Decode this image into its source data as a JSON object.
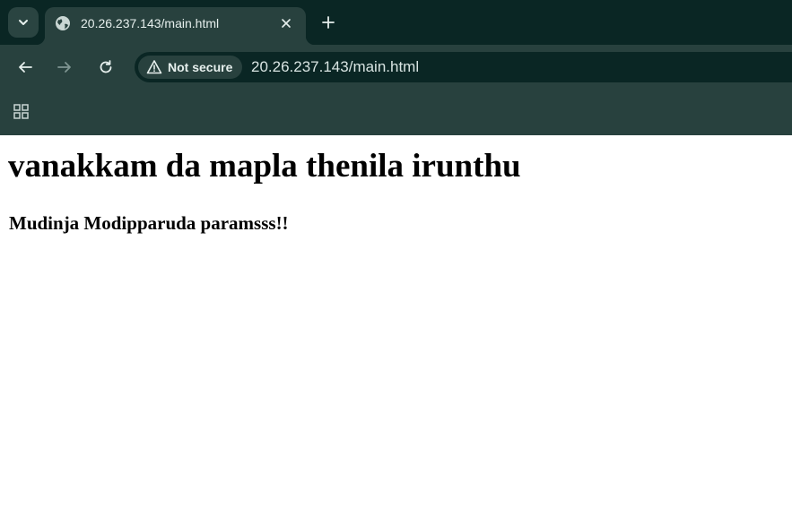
{
  "browser": {
    "tab": {
      "title": "20.26.237.143/main.html",
      "favicon_icon": "globe-icon",
      "close_icon": "close-icon"
    },
    "tab_search_icon": "chevron-down-icon",
    "new_tab_icon": "plus-icon",
    "toolbar": {
      "back_icon": "arrow-left-icon",
      "forward_icon": "arrow-right-icon",
      "reload_icon": "reload-icon",
      "security_label": "Not secure",
      "security_icon": "warning-triangle-icon",
      "url": "20.26.237.143/main.html"
    },
    "bookmarks_bar": {
      "apps_icon": "apps-grid-icon"
    },
    "colors": {
      "tabstrip": "#0a2624",
      "toolbar": "#28413e",
      "text": "#e6efed"
    }
  },
  "page": {
    "heading": "vanakkam da mapla thenila irunthu",
    "subheading": "Mudinja Modipparuda paramsss!!"
  }
}
